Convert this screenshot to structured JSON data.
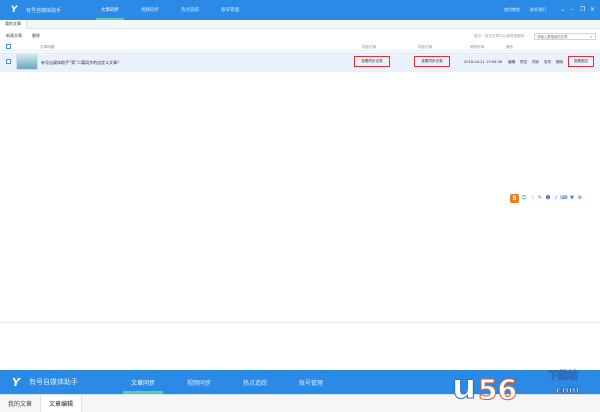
{
  "app": {
    "title": "有号自媒体助手",
    "nav_tabs": [
      {
        "label": "文章同步",
        "active": true
      },
      {
        "label": "视频同步",
        "active": false
      },
      {
        "label": "热点追踪",
        "active": false
      },
      {
        "label": "账号管理",
        "active": false
      }
    ],
    "top_links": [
      "使用教程",
      "联系我们"
    ],
    "window_buttons": [
      "chevron-down-icon",
      "minimize-icon",
      "restore-icon",
      "close-icon"
    ]
  },
  "sub_tabs": [
    {
      "label": "我的文章",
      "active": true
    }
  ],
  "toolbar": {
    "new_label": "新建文章",
    "delete_label": "删除",
    "hint": "提示：双击文章可以修改或删除",
    "search_placeholder": "请输入要搜索的文章"
  },
  "table": {
    "columns": [
      "文章标题",
      "同步记录",
      "同步记录",
      "修改时间",
      "操作"
    ],
    "rows": [
      {
        "title": "有号自媒体助手“第”二篇同步的自定义文章？",
        "sync_record_1": "查看同步记录",
        "sync_record_2": "查看同步记录",
        "modified": "2018-04-21 19:56:38",
        "actions": [
          "编辑",
          "预览",
          "同步",
          "发布",
          "删除",
          "查看图文"
        ]
      }
    ]
  },
  "ime_toolbar": {
    "logo": "S",
    "icons": [
      "emoji-icon",
      "moon-icon",
      "pen-icon",
      "smile-icon",
      "microphone-icon",
      "keyboard-icon",
      "shirt-icon",
      "settings-icon"
    ]
  },
  "bottom": {
    "title": "有号自媒体助手",
    "nav_tabs": [
      {
        "label": "文章同步",
        "active": true
      },
      {
        "label": "视频同步",
        "active": false
      },
      {
        "label": "热点追踪",
        "active": false
      },
      {
        "label": "账号管理",
        "active": false
      }
    ],
    "sub_tabs": [
      {
        "label": "我的文章",
        "active": false
      },
      {
        "label": "文章编辑",
        "active": true
      }
    ]
  },
  "watermark": {
    "big": "u",
    "brand": "下载站",
    "number": "56",
    "domain": "com"
  },
  "colors": {
    "primary": "#2a8ae6",
    "accent": "#5ad0a0",
    "highlight": "#e0302f",
    "row_selected": "#e9f1fc"
  }
}
